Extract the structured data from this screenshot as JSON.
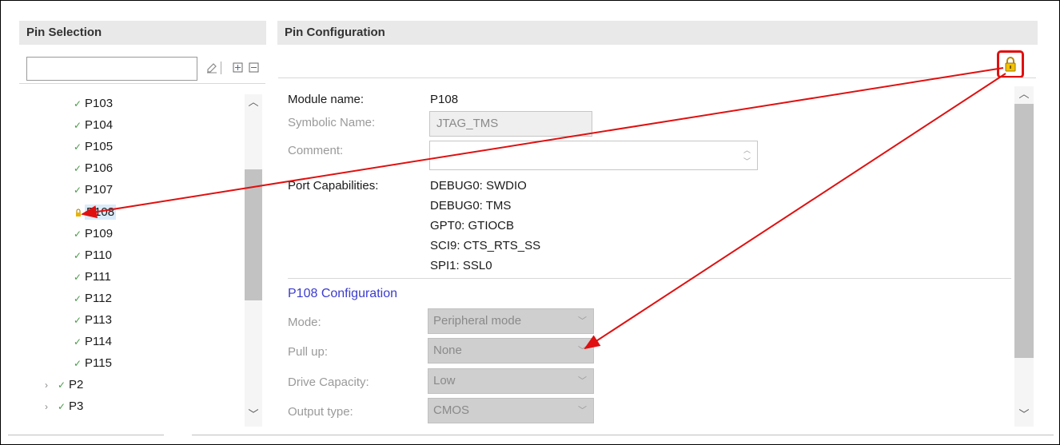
{
  "left_panel": {
    "title": "Pin Selection",
    "filter": {
      "value": "",
      "placeholder": ""
    },
    "tools": {
      "clear": "clear-filter-icon",
      "expand": "expand-all-icon",
      "collapse": "collapse-all-icon"
    },
    "tree_items": [
      {
        "label": "P103",
        "state": "checked"
      },
      {
        "label": "P104",
        "state": "checked"
      },
      {
        "label": "P105",
        "state": "checked"
      },
      {
        "label": "P106",
        "state": "checked"
      },
      {
        "label": "P107",
        "state": "checked"
      },
      {
        "label": "P108",
        "state": "locked",
        "selected": true
      },
      {
        "label": "P109",
        "state": "checked"
      },
      {
        "label": "P110",
        "state": "checked"
      },
      {
        "label": "P111",
        "state": "checked"
      },
      {
        "label": "P112",
        "state": "checked"
      },
      {
        "label": "P113",
        "state": "checked"
      },
      {
        "label": "P114",
        "state": "checked"
      },
      {
        "label": "P115",
        "state": "checked"
      },
      {
        "label": "P2",
        "state": "checked",
        "expandable": true
      },
      {
        "label": "P3",
        "state": "checked",
        "expandable": true
      }
    ]
  },
  "right_panel": {
    "title": "Pin Configuration",
    "lock_icon": "lock-icon",
    "module_name": {
      "label": "Module name:",
      "value": "P108"
    },
    "symbolic_name": {
      "label": "Symbolic Name:",
      "value": "JTAG_TMS"
    },
    "comment": {
      "label": "Comment:",
      "value": ""
    },
    "port_capabilities": {
      "label": "Port Capabilities:",
      "values": [
        "DEBUG0: SWDIO",
        "DEBUG0: TMS",
        "GPT0: GTIOCB",
        "SCI9: CTS_RTS_SS",
        "SPI1: SSL0"
      ]
    },
    "section_title": "P108 Configuration",
    "settings": [
      {
        "label": "Mode:",
        "value": "Peripheral mode"
      },
      {
        "label": "Pull up:",
        "value": "None"
      },
      {
        "label": "Drive Capacity:",
        "value": "Low"
      },
      {
        "label": "Output type:",
        "value": "CMOS"
      }
    ]
  },
  "colors": {
    "annotation": "#e01010",
    "section_title": "#3b3bd0",
    "check": "#4a9a4a",
    "lock": "#e8b400"
  }
}
